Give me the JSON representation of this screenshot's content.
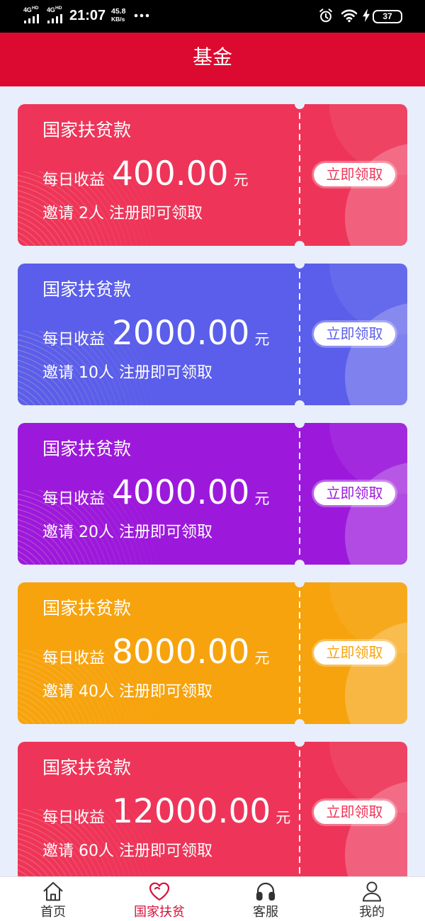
{
  "status_bar": {
    "networks": [
      {
        "type": "4G",
        "badge": "HD"
      },
      {
        "type": "4G",
        "badge": "HD"
      }
    ],
    "time": "21:07",
    "net_speed": {
      "value": "45.8",
      "unit": "KB/s"
    },
    "battery_level": "37",
    "icons": {
      "signal": "signal-bars-icon",
      "more": "more-dots-icon",
      "alarm": "alarm-clock-icon",
      "wifi": "wifi-icon",
      "charging": "charging-bolt-icon",
      "battery": "battery-icon"
    }
  },
  "header": {
    "title": "基金",
    "bg_color": "#DC0A30"
  },
  "page": {
    "bg_color": "#E8EEFB"
  },
  "cards": [
    {
      "title": "国家扶贫款",
      "daily_label": "每日收益",
      "amount": "400.00",
      "unit": "元",
      "invite": "邀请 2人 注册即可领取",
      "button": "立即领取",
      "color": "#EE3559"
    },
    {
      "title": "国家扶贫款",
      "daily_label": "每日收益",
      "amount": "2000.00",
      "unit": "元",
      "invite": "邀请 10人 注册即可领取",
      "button": "立即领取",
      "color": "#5A5EEA"
    },
    {
      "title": "国家扶贫款",
      "daily_label": "每日收益",
      "amount": "4000.00",
      "unit": "元",
      "invite": "邀请 20人 注册即可领取",
      "button": "立即领取",
      "color": "#9C19DC"
    },
    {
      "title": "国家扶贫款",
      "daily_label": "每日收益",
      "amount": "8000.00",
      "unit": "元",
      "invite": "邀请 40人 注册即可领取",
      "button": "立即领取",
      "color": "#F7A30D"
    },
    {
      "title": "国家扶贫款",
      "daily_label": "每日收益",
      "amount": "12000.00",
      "unit": "元",
      "invite": "邀请 60人 注册即可领取",
      "button": "立即领取",
      "color": "#EE3559"
    }
  ],
  "tabbar": {
    "active_color": "#D6103A",
    "inactive_color": "#333333",
    "items": [
      {
        "label": "首页",
        "icon": "home-icon",
        "active": false
      },
      {
        "label": "国家扶贫",
        "icon": "heart-icon",
        "active": true
      },
      {
        "label": "客服",
        "icon": "headset-icon",
        "active": false
      },
      {
        "label": "我的",
        "icon": "user-icon",
        "active": false
      }
    ]
  }
}
